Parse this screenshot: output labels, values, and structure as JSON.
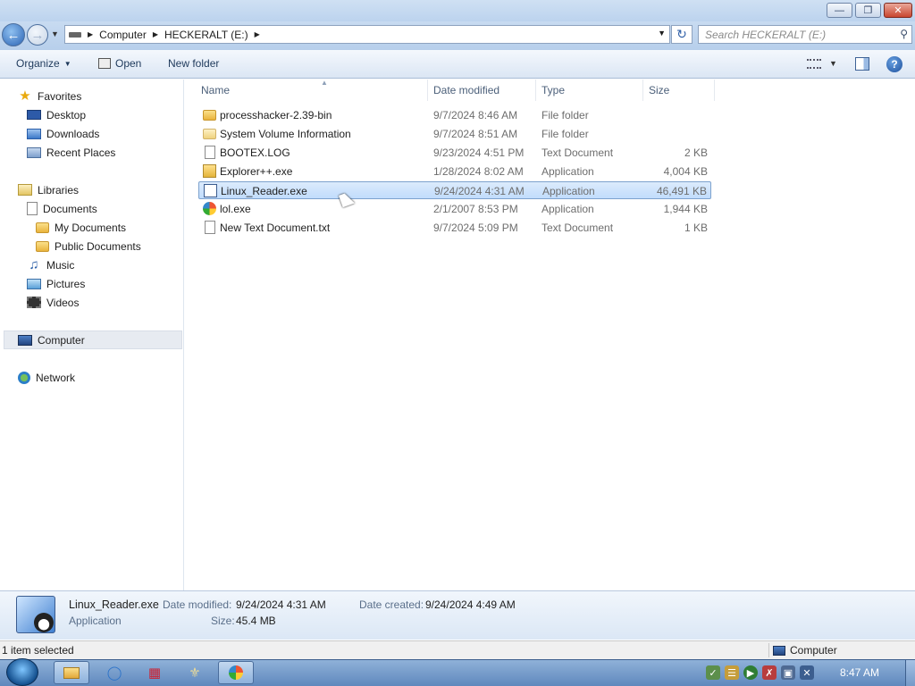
{
  "window": {
    "minimize_glyph": "—",
    "maximize_glyph": "❐",
    "close_glyph": "✕"
  },
  "address_bar": {
    "crumbs": [
      "Computer",
      "HECKERALT (E:)"
    ],
    "search_placeholder": "Search HECKERALT (E:)"
  },
  "command_bar": {
    "organize": "Organize",
    "open": "Open",
    "new_folder": "New folder"
  },
  "nav_pane": {
    "favorites": "Favorites",
    "desktop": "Desktop",
    "downloads": "Downloads",
    "recent_places": "Recent Places",
    "libraries": "Libraries",
    "documents": "Documents",
    "my_documents": "My Documents",
    "public_documents": "Public Documents",
    "music": "Music",
    "pictures": "Pictures",
    "videos": "Videos",
    "computer": "Computer",
    "network": "Network"
  },
  "columns": {
    "name": "Name",
    "date_modified": "Date modified",
    "type": "Type",
    "size": "Size"
  },
  "files": [
    {
      "name": "processhacker-2.39-bin",
      "date": "9/7/2024 8:46 AM",
      "type": "File folder",
      "size": "",
      "icon": "folder-icon"
    },
    {
      "name": "System Volume Information",
      "date": "9/7/2024 8:51 AM",
      "type": "File folder",
      "size": "",
      "icon": "folder-icon"
    },
    {
      "name": "BOOTEX.LOG",
      "date": "9/23/2024 4:51 PM",
      "type": "Text Document",
      "size": "2 KB",
      "icon": "text-file-icon"
    },
    {
      "name": "Explorer++.exe",
      "date": "1/28/2024 8:02 AM",
      "type": "Application",
      "size": "4,004 KB",
      "icon": "app-icon"
    },
    {
      "name": "Linux_Reader.exe",
      "date": "9/24/2024 4:31 AM",
      "type": "Application",
      "size": "46,491 KB",
      "icon": "linux-reader-icon"
    },
    {
      "name": "lol.exe",
      "date": "2/1/2007 8:53 PM",
      "type": "Application",
      "size": "1,944 KB",
      "icon": "browser-icon"
    },
    {
      "name": "New Text Document.txt",
      "date": "9/7/2024 5:09 PM",
      "type": "Text Document",
      "size": "1 KB",
      "icon": "text-file-icon"
    }
  ],
  "details": {
    "name": "Linux_Reader.exe",
    "type": "Application",
    "date_modified_label": "Date modified:",
    "date_modified": "9/24/2024 4:31 AM",
    "date_created_label": "Date created:",
    "date_created": "9/24/2024 4:49 AM",
    "size_label": "Size:",
    "size": "45.4 MB"
  },
  "status_bar": {
    "selection": "1 item selected",
    "location": "Computer"
  },
  "taskbar": {
    "clock": "8:47 AM"
  }
}
